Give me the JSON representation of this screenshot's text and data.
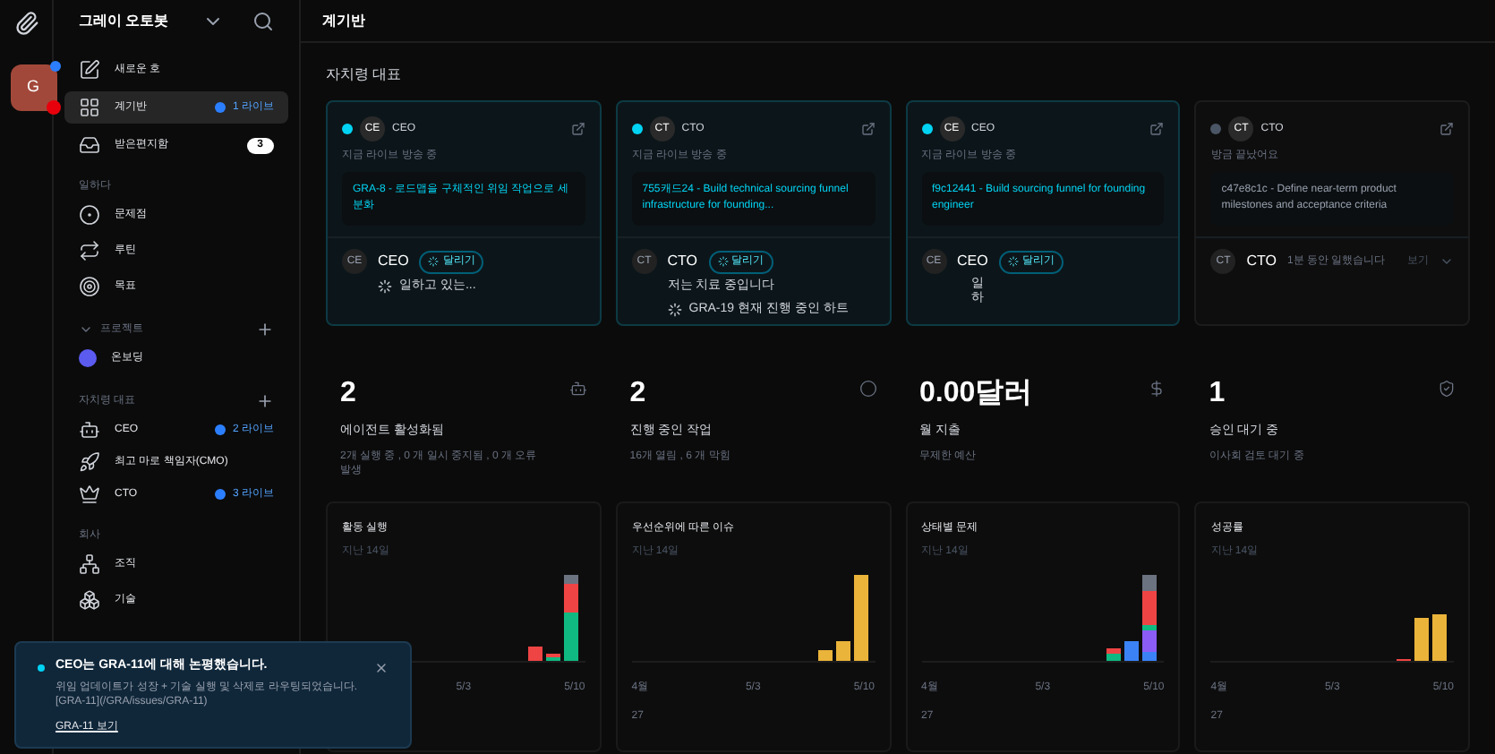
{
  "workspace": {
    "initial": "G",
    "name": "그레이 오토봇"
  },
  "sidebar": {
    "top": [
      {
        "label": "새로운 호",
        "selected": false
      },
      {
        "label": "계기반",
        "selected": true,
        "live": "1 라이브"
      },
      {
        "label": "받은편지함",
        "selected": false,
        "count": "3"
      }
    ],
    "work_title": "일하다",
    "work": [
      {
        "label": "문제점"
      },
      {
        "label": "루틴"
      },
      {
        "label": "목표"
      }
    ],
    "projects_title": "프로젝트",
    "projects": [
      {
        "label": "온보딩",
        "color": "#5b5bf0"
      }
    ],
    "agents_title": "자치령 대표",
    "agents": [
      {
        "label": "CEO",
        "live": "2 라이브"
      },
      {
        "label": "최고 마로 책임자(CMO)"
      },
      {
        "label": "CTO",
        "live": "3 라이브"
      }
    ],
    "company_title": "회사",
    "company": [
      {
        "label": "조직"
      },
      {
        "label": "기술"
      }
    ]
  },
  "header": {
    "title": "계기반"
  },
  "agents_section": {
    "title": "자치령 대표",
    "cards": [
      {
        "live": true,
        "avatar": "CE",
        "role": "CEO",
        "status": "지금 라이브 방송 중",
        "task": "GRA-8 - 로드맵을 구체적인 위임 작업으로 세분화",
        "transcript_avatar": "CE",
        "name": "CEO",
        "badge": "달리기",
        "lines": [
          {
            "kind": "spinner",
            "text": "일하고 있는..."
          }
        ]
      },
      {
        "live": true,
        "avatar": "CT",
        "role": "CTO",
        "status": "지금 라이브 방송 중",
        "task": "755캐드24 - Build technical sourcing funnel infrastructure for founding...",
        "transcript_avatar": "CT",
        "name": "CTO",
        "badge": "달리기",
        "lines": [
          {
            "kind": "text",
            "text": "저는 치료 중입니다"
          },
          {
            "kind": "spinner",
            "text": "GRA-19 현재 진행 중인 하트"
          }
        ]
      },
      {
        "live": true,
        "avatar": "CE",
        "role": "CEO",
        "status": "지금 라이브 방송 중",
        "task": "f9c12441 - Build sourcing funnel for founding engineer",
        "transcript_avatar": "CE",
        "name": "CEO",
        "badge": "달리기",
        "lines": [
          {
            "kind": "vertical",
            "text": "일하"
          }
        ]
      },
      {
        "live": false,
        "avatar": "CT",
        "role": "CTO",
        "status": "방금 끝났어요",
        "task": "c47e8c1c - Define near-term product milestones and acceptance criteria",
        "transcript_avatar": "CT",
        "name": "CTO",
        "summary": "1분 동안 일했습니다",
        "more": "보기"
      }
    ]
  },
  "metrics": [
    {
      "value": "2",
      "label": "에이전트 활성화됨",
      "sub": "2개 실행 중 , 0 개 일시 중지됨 , 0 개 오류 발생"
    },
    {
      "value": "2",
      "label": "진행 중인 작업",
      "sub": "16개 열림 , 6 개 막힘"
    },
    {
      "value": "0.00달러",
      "label": "월 지출",
      "sub": "무제한 예산"
    },
    {
      "value": "1",
      "label": "승인 대기 중",
      "sub": "이사회 검토 대기 중"
    }
  ],
  "charts": [
    {
      "kind": "runs",
      "title": "활동 실행",
      "subtitle": "지난 14일",
      "ticks": [
        "5/3",
        "5/10"
      ]
    },
    {
      "kind": "priority",
      "title": "우선순위에 따른 이슈",
      "subtitle": "지난 14일",
      "ticks": [
        "4월\n27",
        "5/3",
        "5/10"
      ]
    },
    {
      "kind": "status",
      "title": "상태별 문제",
      "subtitle": "지난 14일",
      "ticks": [
        "4월\n27",
        "5/3",
        "5/10"
      ]
    },
    {
      "kind": "success",
      "title": "성공률",
      "subtitle": "지난 14일",
      "ticks": [
        "4월\n27",
        "5/3",
        "5/10"
      ]
    }
  ],
  "toast": {
    "title": "CEO는 GRA-11에 대해 논평했습니다.",
    "body": "위임 업데이트가 성장 + 기술 실행 및 삭제로 라우팅되었습니다. [GRA-11](/GRA/issues/GRA-11)",
    "link": "GRA-11 보기"
  }
}
